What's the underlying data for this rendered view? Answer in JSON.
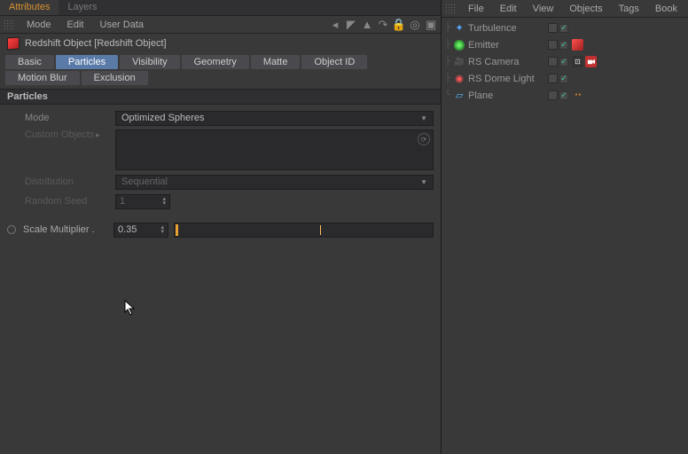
{
  "left": {
    "tabs": {
      "attributes": "Attributes",
      "layers": "Layers"
    },
    "menu": {
      "mode": "Mode",
      "edit": "Edit",
      "userdata": "User Data"
    },
    "obj_title": "Redshift Object [Redshift Object]",
    "ptabs": {
      "basic": "Basic",
      "particles": "Particles",
      "visibility": "Visibility",
      "geometry": "Geometry",
      "matte": "Matte",
      "objectid": "Object ID",
      "motionblur": "Motion Blur",
      "exclusion": "Exclusion"
    },
    "section": "Particles",
    "params": {
      "mode_lbl": "Mode",
      "mode_val": "Optimized Spheres",
      "custom_lbl": "Custom Objects",
      "dist_lbl": "Distribution",
      "dist_val": "Sequential",
      "seed_lbl": "Random Seed",
      "seed_val": "1",
      "scale_lbl": "Scale Multiplier .",
      "scale_val": "0.35"
    }
  },
  "right": {
    "menu": {
      "file": "File",
      "edit": "Edit",
      "view": "View",
      "objects": "Objects",
      "tags": "Tags",
      "book": "Book"
    },
    "items": {
      "turbulence": "Turbulence",
      "emitter": "Emitter",
      "camera": "RS Camera",
      "dome": "RS Dome Light",
      "plane": "Plane"
    }
  },
  "chk_glyph": "✓"
}
